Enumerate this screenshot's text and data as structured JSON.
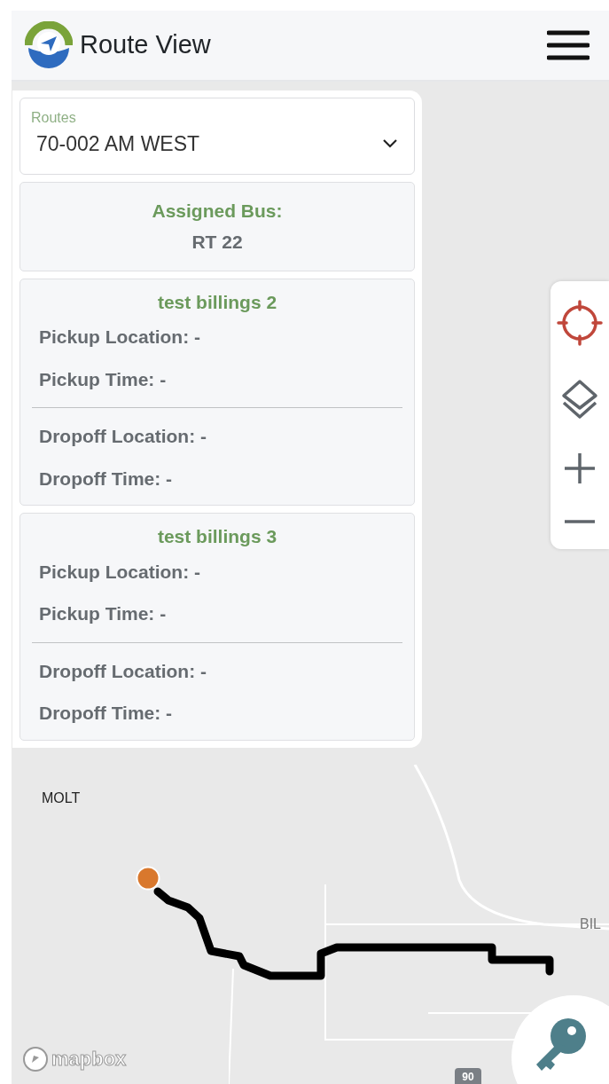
{
  "app": {
    "title": "Route View"
  },
  "route_select": {
    "label": "Routes",
    "value": "70-002 AM WEST"
  },
  "assigned_bus": {
    "label": "Assigned Bus:",
    "value": "RT 22"
  },
  "students": [
    {
      "name": "test billings 2",
      "pickup": [
        "Pickup Location: -",
        "Pickup Time: -"
      ],
      "dropoff": [
        "Dropoff Location: -",
        "Dropoff Time: -"
      ]
    },
    {
      "name": "test billings 3",
      "pickup": [
        "Pickup Location: -",
        "Pickup Time: -"
      ],
      "dropoff": [
        "Dropoff Location: -",
        "Dropoff Time: -"
      ]
    }
  ],
  "map": {
    "place_labels": [
      "MOLT",
      "BIL"
    ],
    "highway_shield": "90",
    "attribution": "mapbox"
  }
}
